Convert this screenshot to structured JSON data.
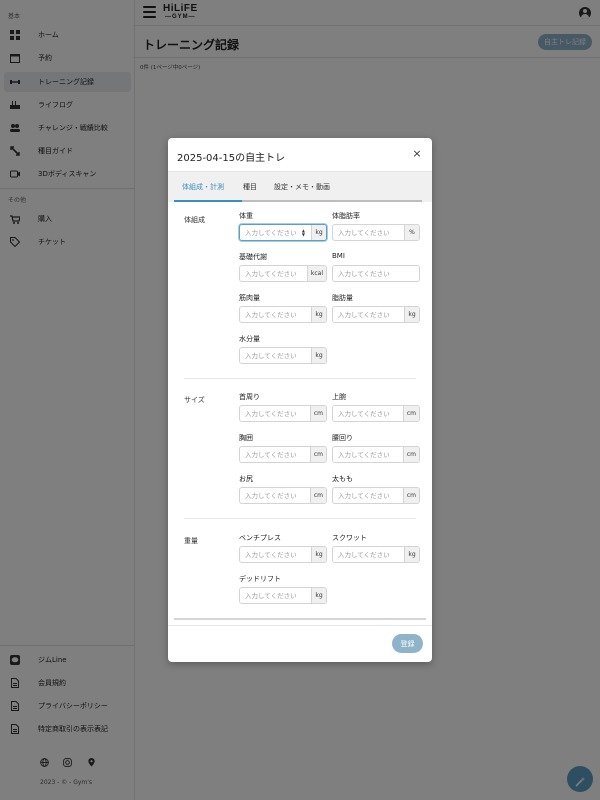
{
  "header": {
    "logo_line1": "HiLiFE",
    "logo_line2": "—GYM—"
  },
  "sidebar": {
    "section_basic": "基本",
    "items": [
      {
        "label": "ホーム",
        "icon": "grid-icon"
      },
      {
        "label": "予約",
        "icon": "calendar-icon"
      },
      {
        "label": "トレーニング記録",
        "icon": "dumbbell-icon"
      },
      {
        "label": "ライフログ",
        "icon": "food-icon"
      },
      {
        "label": "チャレンジ・戦績比較",
        "icon": "group-icon"
      },
      {
        "label": "種目ガイド",
        "icon": "expand-icon"
      },
      {
        "label": "3Dボディスキャン",
        "icon": "scan-icon"
      }
    ],
    "section_other": "その他",
    "other_items": [
      {
        "label": "購入",
        "icon": "cart-icon"
      },
      {
        "label": "チケット",
        "icon": "tag-icon"
      }
    ],
    "bottom_items": [
      {
        "label": "ジムLine",
        "icon": "line-icon"
      },
      {
        "label": "会員規約",
        "icon": "document-icon"
      },
      {
        "label": "プライバシーポリシー",
        "icon": "document-icon"
      },
      {
        "label": "特定商取引の表示表記",
        "icon": "document-icon"
      }
    ],
    "copyright": "2023 - © - Gym's"
  },
  "page": {
    "title": "トレーニング記録",
    "self_button": "自主トレ記録",
    "count": "0件 (1ページ中0ページ)"
  },
  "modal": {
    "title": "2025-04-15の自主トレ",
    "close": "×",
    "tabs": [
      "体組成・計測",
      "種目",
      "設定・メモ・動画"
    ],
    "placeholder": "入力してください",
    "sections": {
      "composition": "体組成",
      "size": "サイズ",
      "weight": "重量"
    },
    "fields": {
      "weight": {
        "label": "体重",
        "unit": "kg"
      },
      "body_fat": {
        "label": "体脂肪率",
        "unit": "%"
      },
      "bmr": {
        "label": "基礎代謝",
        "unit": "kcal"
      },
      "bmi": {
        "label": "BMI"
      },
      "muscle": {
        "label": "筋肉量",
        "unit": "kg"
      },
      "fat": {
        "label": "脂肪量",
        "unit": "kg"
      },
      "water": {
        "label": "水分量",
        "unit": "kg"
      },
      "neck": {
        "label": "首周り",
        "unit": "cm"
      },
      "upper_arm": {
        "label": "上腕",
        "unit": "cm"
      },
      "chest": {
        "label": "胸囲",
        "unit": "cm"
      },
      "waist": {
        "label": "腰回り",
        "unit": "cm"
      },
      "hip": {
        "label": "お尻",
        "unit": "cm"
      },
      "thigh": {
        "label": "太もも",
        "unit": "cm"
      },
      "bench": {
        "label": "ベンチプレス",
        "unit": "kg"
      },
      "squat": {
        "label": "スクワット",
        "unit": "kg"
      },
      "deadlift": {
        "label": "デッドリフト",
        "unit": "kg"
      }
    },
    "register_button": "登録"
  }
}
